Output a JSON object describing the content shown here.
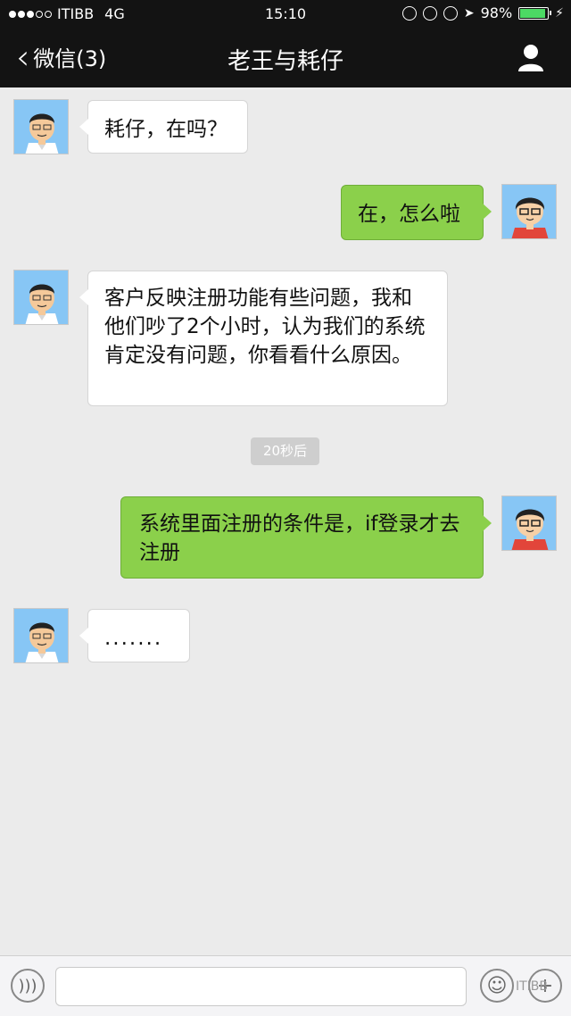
{
  "status_bar": {
    "carrier": "ITIBB",
    "network": "4G",
    "time": "15:10",
    "battery_percent": "98%",
    "battery_level": 0.98,
    "signal_full": 3,
    "signal_total": 5
  },
  "nav": {
    "back_label": "微信(3)",
    "title": "老王与耗仔"
  },
  "messages": [
    {
      "direction": "incoming",
      "sender": "laowang",
      "text": "耗仔，在吗？"
    },
    {
      "direction": "outgoing",
      "sender": "haozai",
      "text": "在，怎么啦"
    },
    {
      "direction": "incoming",
      "sender": "laowang",
      "text": "客户反映注册功能有些问题，我和他们吵了2个小时，认为我们的系统肯定没有问题，你看看什么原因。"
    },
    {
      "direction": "outgoing",
      "sender": "haozai",
      "text": "系统里面注册的条件是，if登录才去注册"
    },
    {
      "direction": "incoming",
      "sender": "laowang",
      "text": "......."
    }
  ],
  "timestamp_label": "20秒后",
  "input_bar": {
    "watermark": "ITIBB",
    "input_value": ""
  },
  "colors": {
    "bar_bg": "#131313",
    "chat_bg": "#ebebeb",
    "outgoing_bubble": "#8bd04b",
    "incoming_bubble": "#ffffff",
    "avatar_bg": "#87c6f5"
  }
}
